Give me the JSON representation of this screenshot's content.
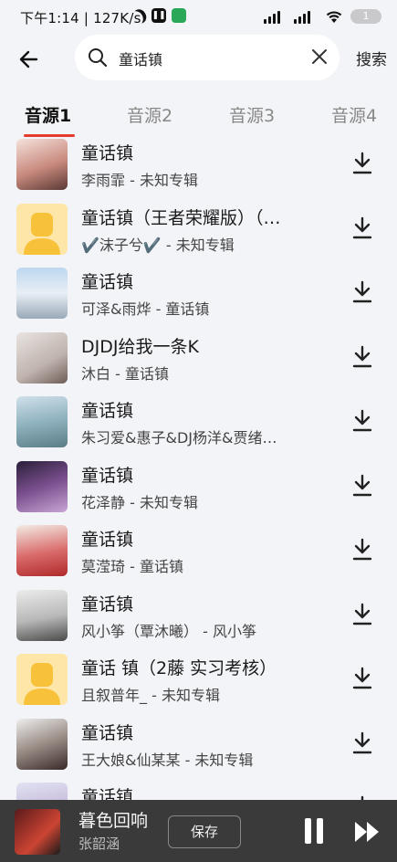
{
  "status_bar": {
    "time": "下午1:14 | 127K/s",
    "battery": "1"
  },
  "search": {
    "value": "童话镇",
    "button_label": "搜索"
  },
  "tabs": [
    "音源1",
    "音源2",
    "音源3",
    "音源4"
  ],
  "active_tab": 0,
  "songs": [
    {
      "title": "童话镇",
      "subtitle": "李雨霏 - 未知专辑",
      "cover": "photo"
    },
    {
      "title": "童话镇（王者荣耀版）（…",
      "subtitle": "✔️沫子兮✔️ - 未知专辑",
      "cover": "placeholder"
    },
    {
      "title": "童话镇",
      "subtitle": "可泽&雨烨 - 童话镇",
      "cover": "photo"
    },
    {
      "title": "DJDJ给我一条K",
      "subtitle": "沐白 - 童话镇",
      "cover": "photo"
    },
    {
      "title": "童话镇",
      "subtitle": "朱习爱&惠子&DJ杨洋&贾绪…",
      "cover": "photo"
    },
    {
      "title": "童话镇",
      "subtitle": "花泽静 - 未知专辑",
      "cover": "photo"
    },
    {
      "title": "童话镇",
      "subtitle": "莫滢琦 - 童话镇",
      "cover": "photo"
    },
    {
      "title": "童话镇",
      "subtitle": "风小筝（覃沐曦） - 风小筝",
      "cover": "photo"
    },
    {
      "title": "童话 镇（2藤 实习考核）",
      "subtitle": "且叙普年_ - 未知专辑",
      "cover": "placeholder"
    },
    {
      "title": "童话镇",
      "subtitle": "王大娘&仙某某 - 未知专辑",
      "cover": "photo"
    },
    {
      "title": "童话镇",
      "subtitle": "",
      "cover": "photo"
    }
  ],
  "player": {
    "title": "暮色回响",
    "artist": "张韶涵",
    "save_label": "保存"
  },
  "colors": {
    "accent": "#e53b2f",
    "placeholder_bg": "#fde6a8",
    "placeholder_fg": "#f7c23a",
    "player_bg": "#3a3a3a"
  }
}
